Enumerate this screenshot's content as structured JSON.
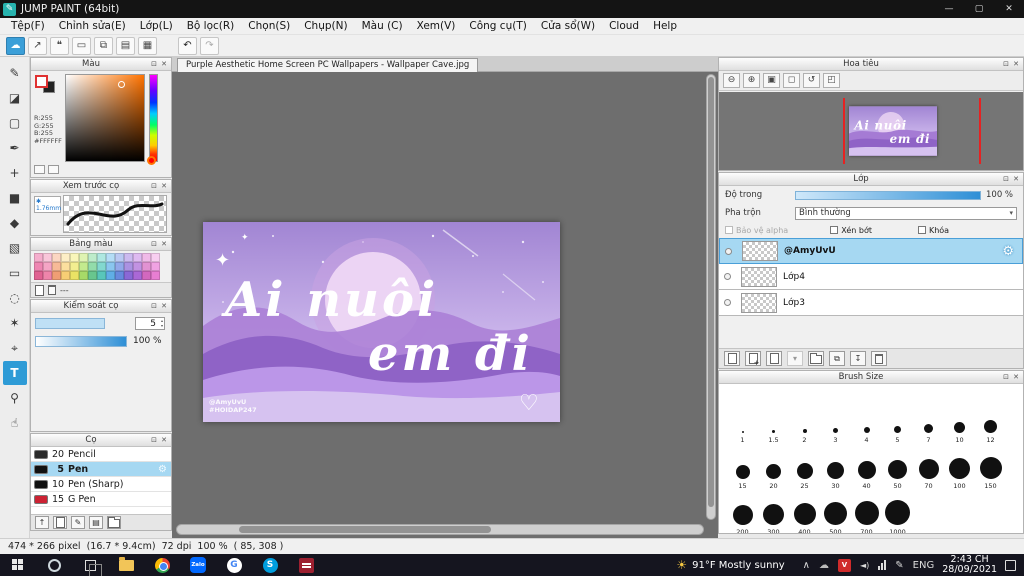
{
  "titlebar": {
    "title": "JUMP PAINT (64bit)"
  },
  "menu": {
    "items": [
      "Tệp(F)",
      "Chỉnh sửa(E)",
      "Lớp(L)",
      "Bộ lọc(R)",
      "Chọn(S)",
      "Chụp(N)",
      "Màu (C)",
      "Xem(V)",
      "Công cụ(T)",
      "Cửa sổ(W)",
      "Cloud",
      "Help"
    ]
  },
  "icons": {
    "app": "✎",
    "minimize": "—",
    "maximize": "▢",
    "close": "✕",
    "panel_detach": "⊡",
    "panel_close": "✕",
    "toolbar": [
      "☁",
      "↗",
      "❝",
      "▭",
      "⧉",
      "▤",
      "▦"
    ],
    "undo": "↶",
    "redo": "↷",
    "tools": [
      "✎",
      "◪",
      "▢",
      "✒",
      "+",
      "■",
      "◆",
      "▧",
      "▭",
      "◌",
      "✶",
      "⌖",
      "T",
      "⚲",
      "☝"
    ],
    "navigator": [
      "⊖",
      "⊕",
      "▣",
      "◻",
      "↺",
      "◰"
    ],
    "gear": "⚙",
    "caret": "▾",
    "heart": "♡",
    "sparkle": "✦",
    "star": "✱",
    "up_arrow": "↑",
    "list": "▤",
    "pen": "✎",
    "copy": "⧉",
    "merge": "↧",
    "tray_up": "∧",
    "tray_cloud": "☁",
    "tray_vlc": "V",
    "tray_speaker": "◄)",
    "sun": "☀"
  },
  "document": {
    "tab_title": "Purple Aesthetic Home Screen PC Wallpapers - Wallpaper Cave.jpg",
    "artwork": {
      "line1": "Ai nuôi",
      "line2": "em đi",
      "watermark_line1": "@AmyUvU",
      "watermark_line2": "#HOIDAP247"
    }
  },
  "color_panel": {
    "title": "Màu",
    "r": "R:255",
    "g": "G:255",
    "b": "B:255",
    "hex": "#FFFFFF"
  },
  "brush_preview_panel": {
    "title": "Xem trước cọ",
    "size": "1.76mm"
  },
  "palette_panel": {
    "title": "Bảng màu",
    "divider": "---",
    "colors": [
      "#f5aecd",
      "#f9c6da",
      "#fbd6c2",
      "#fdeec6",
      "#f9f6ba",
      "#dff3b2",
      "#bdecca",
      "#aee8e1",
      "#b4ddf6",
      "#bac9f3",
      "#ccbaf0",
      "#debaf1",
      "#f0bae8",
      "#f8cef0",
      "#ee86b2",
      "#f5a5c5",
      "#f7ba97",
      "#fbdf9e",
      "#f2ee90",
      "#c3ea8e",
      "#92dcaa",
      "#82d8cf",
      "#8ac6ef",
      "#92a9ea",
      "#ab92e2",
      "#c292e2",
      "#e292d2",
      "#f0a2e2",
      "#e06292",
      "#ee84aa",
      "#ef9e74",
      "#f7ce74",
      "#eae364",
      "#a6da68",
      "#68c68e",
      "#58c6ba",
      "#60aee6",
      "#688ade",
      "#8a68d6",
      "#aa68d6",
      "#d268be",
      "#e87ed2"
    ]
  },
  "brush_control_panel": {
    "title": "Kiểm soát cọ",
    "size_value": "5",
    "opacity_value": "100 %"
  },
  "brush_panel": {
    "title": "Cọ",
    "items": [
      {
        "size": "20",
        "name": "Pencil",
        "chip": "#2b2b2b"
      },
      {
        "size": "5",
        "name": "Pen",
        "chip": "#111111"
      },
      {
        "size": "10",
        "name": "Pen (Sharp)",
        "chip": "#111111"
      },
      {
        "size": "15",
        "name": "G Pen",
        "chip": "#cc2233"
      }
    ]
  },
  "navigator_panel": {
    "title": "Hoa tiêu"
  },
  "layers_panel": {
    "title": "Lớp",
    "opacity_label": "Độ trong",
    "opacity_value": "100 %",
    "blend_label": "Pha trộn",
    "blend_value": "Bình thường",
    "check1": "Bảo vệ alpha",
    "check2": "Xén bớt",
    "check3": "Khóa",
    "layers": [
      {
        "name": "@AmyUvU"
      },
      {
        "name": "Lớp4"
      },
      {
        "name": "Lớp3"
      }
    ]
  },
  "brush_size_panel": {
    "title": "Brush Size",
    "sizes": [
      {
        "label": "1",
        "d": 2
      },
      {
        "label": "1.5",
        "d": 3
      },
      {
        "label": "2",
        "d": 4
      },
      {
        "label": "3",
        "d": 5
      },
      {
        "label": "4",
        "d": 6
      },
      {
        "label": "5",
        "d": 7
      },
      {
        "label": "7",
        "d": 9
      },
      {
        "label": "10",
        "d": 11
      },
      {
        "label": "12",
        "d": 13
      },
      {
        "label": "15",
        "d": 14
      },
      {
        "label": "20",
        "d": 15
      },
      {
        "label": "25",
        "d": 16
      },
      {
        "label": "30",
        "d": 17
      },
      {
        "label": "40",
        "d": 18
      },
      {
        "label": "50",
        "d": 19
      },
      {
        "label": "70",
        "d": 20
      },
      {
        "label": "100",
        "d": 21
      },
      {
        "label": "150",
        "d": 22
      },
      {
        "label": "200",
        "d": 20
      },
      {
        "label": "300",
        "d": 21
      },
      {
        "label": "400",
        "d": 22
      },
      {
        "label": "500",
        "d": 23
      },
      {
        "label": "700",
        "d": 24
      },
      {
        "label": "1000",
        "d": 25
      }
    ]
  },
  "status_bar": {
    "text": "474 * 266 pixel  (16.7 * 9.4cm)  72 dpi  100 %  ( 85, 308 )"
  },
  "taskbar": {
    "zalo_label": "Zalo",
    "google_label": "G",
    "skype_label": "S",
    "weather": "91°F Mostly sunny",
    "language": "ENG",
    "time": "2:43 CH",
    "date": "28/09/2021"
  },
  "colors": {
    "titlebar_bg": "#141414",
    "accent_blue": "#2e9bd6",
    "selection_blue": "#a6d8f2",
    "canvas_bg": "#6e6e6e",
    "taskbar_bg": "#15151f"
  }
}
